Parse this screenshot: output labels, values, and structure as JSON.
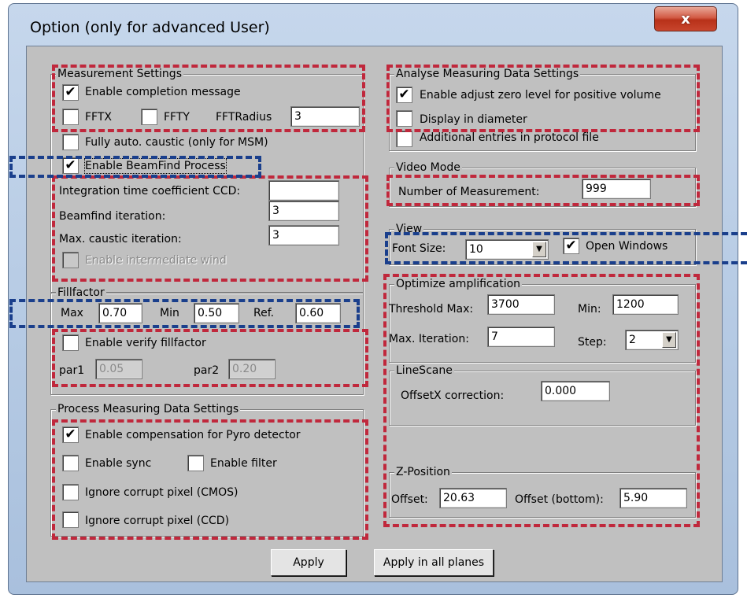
{
  "window": {
    "title": "Option (only for advanced User)",
    "close_glyph": "x"
  },
  "measurement": {
    "title": "Measurement Settings",
    "enable_completion": "Enable completion message",
    "enable_completion_checked": "✔",
    "fftx": "FFTX",
    "ffty": "FFTY",
    "fftradius_label": "FFTRadius",
    "fftradius_value": "3",
    "fully_auto": "Fully auto. caustic (only for MSM)",
    "enable_beamfind": "Enable BeamFind Process",
    "enable_beamfind_checked": "✔",
    "integration_label": "Integration time coefficient CCD:",
    "integration_value": "",
    "beamfind_iter_label": "Beamfind iteration:",
    "beamfind_iter_value": "3",
    "max_caustic_label": "Max. caustic iteration:",
    "max_caustic_value": "3",
    "enable_intermediate": "Enable intermediate wind"
  },
  "fillfactor": {
    "title": "Fillfactor",
    "max_label": "Max",
    "max_value": "0.70",
    "min_label": "Min",
    "min_value": "0.50",
    "ref_label": "Ref.",
    "ref_value": "0.60",
    "verify": "Enable verify fillfactor",
    "par1_label": "par1",
    "par1_value": "0.05",
    "par2_label": "par2",
    "par2_value": "0.20"
  },
  "process": {
    "title": "Process Measuring Data Settings",
    "pyro": "Enable compensation for Pyro detector",
    "pyro_checked": "✔",
    "sync": "Enable sync",
    "filter": "Enable filter",
    "ignore_cmos": "Ignore corrupt pixel (CMOS)",
    "ignore_ccd": "Ignore corrupt pixel (CCD)"
  },
  "analyse": {
    "title": "Analyse Measuring Data Settings",
    "adjust_zero": "Enable adjust zero level for positive volume",
    "adjust_zero_checked": "✔",
    "diameter": "Display in diameter",
    "additional": "Additional entries in protocol file"
  },
  "video": {
    "title": "Video Mode",
    "num_label": "Number of Measurement:",
    "num_value": "999"
  },
  "view": {
    "title": "View",
    "font_label": "Font Size:",
    "font_value": "10",
    "open_windows": "Open Windows",
    "open_windows_checked": "✔"
  },
  "optimize": {
    "title": "Optimize amplification",
    "threshold_label": "Threshold Max:",
    "threshold_value": "3700",
    "min_label": "Min:",
    "min_value": "1200",
    "max_iter_label": "Max. Iteration:",
    "max_iter_value": "7",
    "step_label": "Step:",
    "step_value": "2"
  },
  "linescan": {
    "title": "LineScane",
    "offsetx_label": "OffsetX correction:",
    "offsetx_value": "0.000"
  },
  "zpos": {
    "title": "Z-Position",
    "offset_label": "Offset:",
    "offset_value": "20.63",
    "offset_bottom_label": "Offset (bottom):",
    "offset_bottom_value": "5.90"
  },
  "buttons": {
    "apply": "Apply",
    "apply_all": "Apply in  all planes"
  }
}
